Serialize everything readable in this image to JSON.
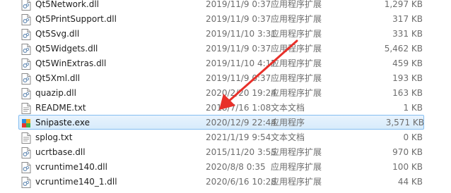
{
  "files": [
    {
      "name": "Qt5Network.dll",
      "date": "2019/11/9 0:37",
      "type": "应用程序扩展",
      "size": "1,297 KB",
      "icon": "dll-icon"
    },
    {
      "name": "Qt5PrintSupport.dll",
      "date": "2019/11/9 0:37",
      "type": "应用程序扩展",
      "size": "317 KB",
      "icon": "dll-icon"
    },
    {
      "name": "Qt5Svg.dll",
      "date": "2019/11/10 3:31",
      "type": "应用程序扩展",
      "size": "331 KB",
      "icon": "dll-icon"
    },
    {
      "name": "Qt5Widgets.dll",
      "date": "2019/11/9 0:37",
      "type": "应用程序扩展",
      "size": "5,462 KB",
      "icon": "dll-icon"
    },
    {
      "name": "Qt5WinExtras.dll",
      "date": "2019/11/10 4:17",
      "type": "应用程序扩展",
      "size": "459 KB",
      "icon": "dll-icon"
    },
    {
      "name": "Qt5Xml.dll",
      "date": "2019/11/9 0:37",
      "type": "应用程序扩展",
      "size": "193 KB",
      "icon": "dll-icon"
    },
    {
      "name": "quazip.dll",
      "date": "2020/2/20 19:24",
      "type": "应用程序扩展",
      "size": "163 KB",
      "icon": "dll-icon"
    },
    {
      "name": "README.txt",
      "date": "2018/7/16 1:08",
      "type": "文本文档",
      "size": "1 KB",
      "icon": "txt-icon"
    },
    {
      "name": "Snipaste.exe",
      "date": "2020/12/9 22:44",
      "type": "应用程序",
      "size": "3,571 KB",
      "icon": "exe-icon",
      "selected": true
    },
    {
      "name": "splog.txt",
      "date": "2021/1/19 9:54",
      "type": "文本文档",
      "size": "0 KB",
      "icon": "txt-icon"
    },
    {
      "name": "ucrtbase.dll",
      "date": "2015/11/20 3:55",
      "type": "应用程序扩展",
      "size": "970 KB",
      "icon": "dll-icon"
    },
    {
      "name": "vcruntime140.dll",
      "date": "2020/8/8 0:35",
      "type": "应用程序扩展",
      "size": "100 KB",
      "icon": "dll-icon"
    },
    {
      "name": "vcruntime140_1.dll",
      "date": "2020/6/16 10:28",
      "type": "应用程序扩展",
      "size": "44 KB",
      "icon": "dll-icon"
    }
  ],
  "colors": {
    "selection_bg": "#d7ebfb",
    "selection_border": "#84bdf0",
    "arrow": "#e8302a"
  }
}
